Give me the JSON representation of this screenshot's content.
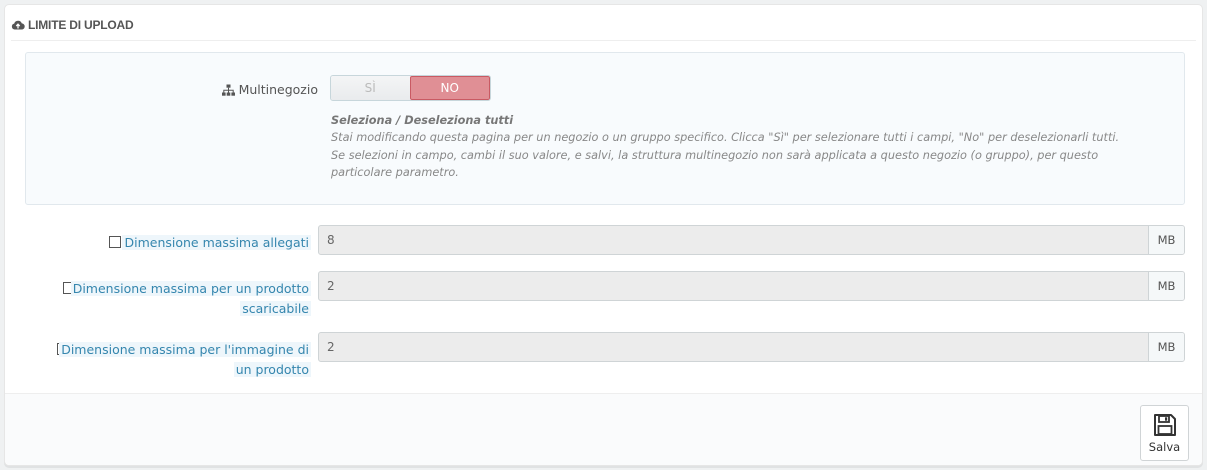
{
  "panel": {
    "title": "LIMITE DI UPLOAD",
    "title_icon": "cloud-upload-icon"
  },
  "multistore": {
    "label": "Multinegozio",
    "label_icon": "sitemap-icon",
    "switch": {
      "yes_label": "SÌ",
      "no_label": "NO",
      "selected": "NO"
    },
    "help_title": "Seleziona / Deseleziona tutti",
    "help_line1": "Stai modificando questa pagina per un negozio o un gruppo specifico. Clicca \"Sì\" per selezionare tutti i campi, \"No\" per deselezionarli tutti.",
    "help_line2": "Se selezioni in campo, cambi il suo valore, e salvi, la struttura multinegozio non sarà applicata a questo negozio (o gruppo), per questo particolare parametro."
  },
  "fields": [
    {
      "label": "Dimensione massima allegati",
      "value": "8",
      "unit": "MB"
    },
    {
      "label_line1": "Dimensione massima per un prodotto",
      "label_line2": "scaricabile",
      "value": "2",
      "unit": "MB"
    },
    {
      "label_line1": "Dimensione massima per l'immagine di",
      "label_line2": "un prodotto",
      "value": "2",
      "unit": "MB"
    }
  ],
  "footer": {
    "save_label": "Salva",
    "save_icon": "floppy-disk-icon"
  },
  "colors": {
    "no_active": "#e08f95",
    "label_link": "#3586ae"
  }
}
